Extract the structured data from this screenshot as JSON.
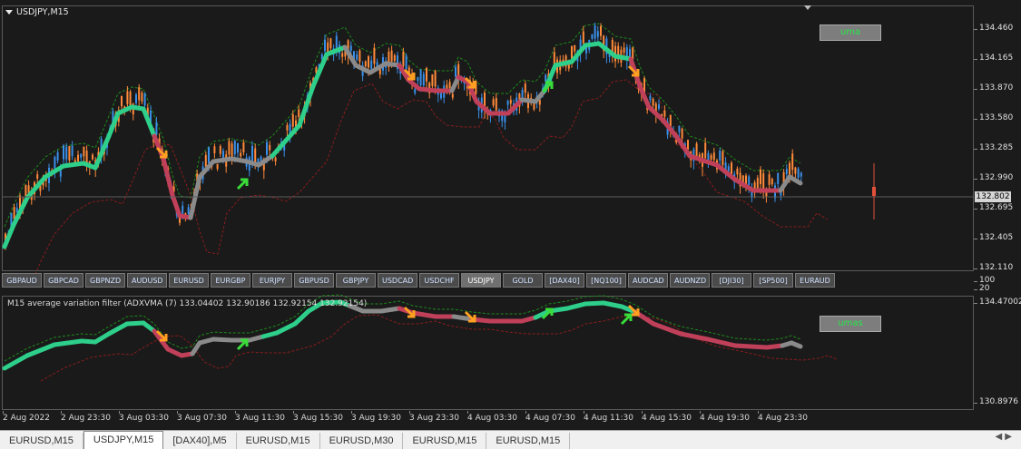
{
  "chart_title": "USDJPY,M15",
  "main_label": "uma",
  "sub_label": "umas",
  "current_price": "132.802",
  "price_ticks": [
    "134.460",
    "134.165",
    "133.870",
    "133.580",
    "133.285",
    "132.990",
    "132.695",
    "132.405",
    "132.110"
  ],
  "sub_scale_ticks": [
    "100",
    "20",
    "134.47002",
    "130.8976"
  ],
  "symbols": [
    "GBPAUD",
    "GBPCAD",
    "GBPNZD",
    "AUDUSD",
    "EURUSD",
    "EURGBP",
    "EURJPY",
    "GBPUSD",
    "GBPJPY",
    "USDCAD",
    "USDCHF",
    "USDJPY",
    "GOLD",
    "[DAX40]",
    "[NQ100]",
    "AUDCAD",
    "AUDNZD",
    "[DJI30]",
    "[SP500]",
    "EURAUD"
  ],
  "active_symbol": "USDJPY",
  "indicator_title": "M15 average variation filter (ADXVMA (7) 133.04402 132.90186 132.92154 132.92154)",
  "time_labels": [
    "2 Aug 2022",
    "2 Aug 23:30",
    "3 Aug 03:30",
    "3 Aug 07:30",
    "3 Aug 11:30",
    "3 Aug 15:30",
    "3 Aug 19:30",
    "3 Aug 23:30",
    "4 Aug 03:30",
    "4 Aug 07:30",
    "4 Aug 11:30",
    "4 Aug 15:30",
    "4 Aug 19:30",
    "4 Aug 23:30"
  ],
  "tabs": [
    "EURUSD,M15",
    "USDJPY,M15",
    "[DAX40],M5",
    "EURUSD,M15",
    "EURUSD,M30",
    "EURUSD,M15",
    "EURUSD,M15"
  ],
  "active_tab": "USDJPY,M15",
  "colors": {
    "up_line": "#2ecf8a",
    "down_line": "#c0405a",
    "flat_line": "#8a8a8a",
    "bull_candle": "#3a8fe8",
    "bear_candle": "#ff8a3a",
    "band_up": "#1c8a1c",
    "band_down": "#8a1c1c",
    "arrow_up": "#3adc3a",
    "arrow_down": "#ffa020"
  }
}
